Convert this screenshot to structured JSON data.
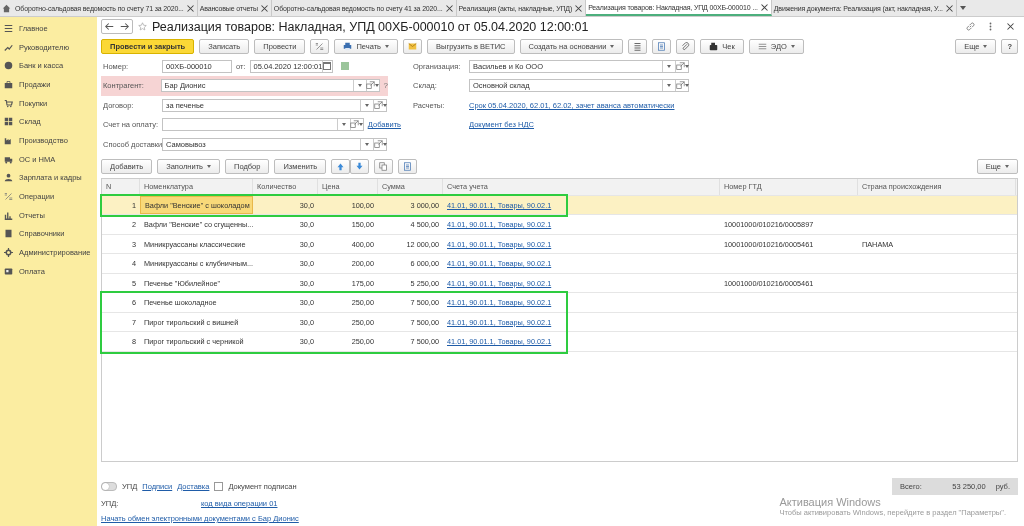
{
  "tabs": [
    {
      "label": "Оборотно-сальдовая ведомость по счету 71 за 2020...",
      "selected": false
    },
    {
      "label": "Авансовые отчеты",
      "selected": false
    },
    {
      "label": "Оборотно-сальдовая ведомость по счету 41 за 2020...",
      "selected": false
    },
    {
      "label": "Реализация (акты, накладные, УПД)",
      "selected": false
    },
    {
      "label": "Реализация товаров: Накладная, УПД 00ХБ-000010 ...",
      "selected": true
    },
    {
      "label": "Движения документа: Реализация (акт, накладная, У...",
      "selected": false
    }
  ],
  "sidebar": {
    "items": [
      {
        "label": "Главное"
      },
      {
        "label": "Руководителю"
      },
      {
        "label": "Банк и касса"
      },
      {
        "label": "Продажи"
      },
      {
        "label": "Покупки"
      },
      {
        "label": "Склад"
      },
      {
        "label": "Производство"
      },
      {
        "label": "ОС и НМА"
      },
      {
        "label": "Зарплата и кадры"
      },
      {
        "label": "Операции"
      },
      {
        "label": "Отчеты"
      },
      {
        "label": "Справочники"
      },
      {
        "label": "Администрирование"
      },
      {
        "label": "Оплата"
      }
    ]
  },
  "window": {
    "title": "Реализация товаров: Накладная, УПД 00ХБ-000010 от 05.04.2020 12:00:01"
  },
  "toolbar": [
    {
      "kind": "primary",
      "label": "Провести и закрыть"
    },
    {
      "kind": "button",
      "label": "Записать"
    },
    {
      "kind": "button",
      "label": "Провести"
    },
    {
      "kind": "icon"
    },
    {
      "kind": "menu",
      "label": "Печать"
    },
    {
      "kind": "icon"
    },
    {
      "kind": "button",
      "label": "Выгрузить в ВЕТИС"
    },
    {
      "kind": "menu",
      "label": "Создать на основании"
    },
    {
      "kind": "icon"
    },
    {
      "kind": "icon"
    },
    {
      "kind": "icon"
    },
    {
      "kind": "button",
      "label": "Чек"
    },
    {
      "kind": "menu",
      "label": "ЭДО"
    }
  ],
  "more_button": "Еще",
  "help_button": "?",
  "fields_left": [
    {
      "label": "Номер:",
      "value": "00ХБ-000010",
      "date_label": "от:",
      "date": "05.04.2020 12:00:01",
      "kind": "number"
    },
    {
      "label": "Контрагент:",
      "value": "Бар Дионис",
      "kind": "select",
      "error": true,
      "hint": "?"
    },
    {
      "label": "Договор:",
      "value": "за печенье",
      "kind": "select",
      "error": false
    },
    {
      "label": "Счет на оплату:",
      "kind": "select",
      "error": false,
      "link": "Добавить"
    },
    {
      "label": "Способ доставки:",
      "value": "Самовывоз",
      "kind": "select",
      "error": false
    }
  ],
  "fields_right": [
    {
      "label": "Организация:",
      "value": "Васильев и Ко ООО",
      "kind": "select"
    },
    {
      "label": "Склад:",
      "value": "Основной склад",
      "kind": "select"
    },
    {
      "label": "Расчеты:",
      "value": "Срок 05.04.2020, 62.01, 62.02, зачет аванса автоматически",
      "kind": "link"
    },
    {
      "value": "Документ без НДС",
      "kind": "link"
    }
  ],
  "table_toolbar": [
    {
      "kind": "button",
      "label": "Добавить"
    },
    {
      "kind": "menu",
      "label": "Заполнить"
    },
    {
      "kind": "button",
      "label": "Подбор"
    },
    {
      "kind": "button",
      "label": "Изменить"
    },
    {
      "kind": "arrows"
    },
    {
      "kind": "icon"
    },
    {
      "kind": "icon"
    }
  ],
  "table_more": "Еще",
  "table": {
    "columns": [
      "N",
      "Номенклатура",
      "Количество",
      "Цена",
      "Сумма",
      "Счета учета",
      "Номер ГТД",
      "Страна происхождения"
    ],
    "rows": [
      {
        "selected": true,
        "outlined": true,
        "cells": [
          "1",
          "Вафли \"Венские\" с шоколадом",
          "30,0",
          "100,00",
          "3 000,00",
          "41.01, 90.01.1, Товары, 90.02.1",
          "",
          ""
        ]
      },
      {
        "selected": false,
        "outlined": false,
        "cells": [
          "2",
          "Вафли \"Венские\" со сгущенны...",
          "30,0",
          "150,00",
          "4 500,00",
          "41.01, 90.01.1, Товары, 90.02.1",
          "10001000/010216/0005897",
          ""
        ]
      },
      {
        "selected": false,
        "outlined": false,
        "cells": [
          "3",
          "Миникруассаны классические",
          "30,0",
          "400,00",
          "12 000,00",
          "41.01, 90.01.1, Товары, 90.02.1",
          "10001000/010216/0005461",
          "ПАНАМА"
        ]
      },
      {
        "selected": false,
        "outlined": false,
        "cells": [
          "4",
          "Миникруассаны с клубничным...",
          "30,0",
          "200,00",
          "6 000,00",
          "41.01, 90.01.1, Товары, 90.02.1",
          "",
          ""
        ]
      },
      {
        "selected": false,
        "outlined": false,
        "cells": [
          "5",
          "Печенье \"Юбилейное\"",
          "30,0",
          "175,00",
          "5 250,00",
          "41.01, 90.01.1, Товары, 90.02.1",
          "10001000/010216/0005461",
          ""
        ]
      },
      {
        "selected": false,
        "outlined": true,
        "cells": [
          "6",
          "Печенье шоколадное",
          "30,0",
          "250,00",
          "7 500,00",
          "41.01, 90.01.1, Товары, 90.02.1",
          "",
          ""
        ]
      },
      {
        "selected": false,
        "outlined": true,
        "cells": [
          "7",
          "Пирог тирольский с вишней",
          "30,0",
          "250,00",
          "7 500,00",
          "41.01, 90.01.1, Товары, 90.02.1",
          "",
          ""
        ]
      },
      {
        "selected": false,
        "outlined": true,
        "cells": [
          "8",
          "Пирог тирольский с черникой",
          "30,0",
          "250,00",
          "7 500,00",
          "41.01, 90.01.1, Товары, 90.02.1",
          "",
          ""
        ]
      }
    ]
  },
  "footer": {
    "upd_toggle": {
      "label": "УПД",
      "on": false
    },
    "links": [
      "Подписи",
      "Доставка"
    ],
    "signed": {
      "label": "Документ подписан",
      "checked": false
    },
    "total_label": "Всего:",
    "total": "53 250,00",
    "currency": "руб.",
    "upd_label": "УПД:",
    "upd_link": "код вида операции 01",
    "exchange_link": "Начать обмен электронными документами с Бар Дионис"
  },
  "activation": {
    "title": "Активация Windows",
    "text": "Чтобы активировать Windows, перейдите в раздел \"Параметры\"."
  }
}
